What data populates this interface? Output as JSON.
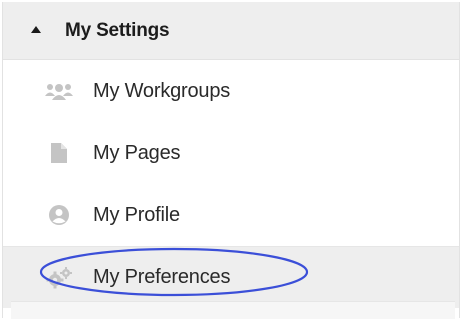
{
  "section": {
    "title": "My Settings",
    "expanded": true
  },
  "menu": {
    "items": [
      {
        "label": "My Workgroups",
        "icon": "users-icon"
      },
      {
        "label": "My Pages",
        "icon": "document-icon"
      },
      {
        "label": "My Profile",
        "icon": "user-circle-icon"
      },
      {
        "label": "My Preferences",
        "icon": "gears-icon",
        "selected": true
      }
    ]
  },
  "colors": {
    "header_bg": "#eeeeee",
    "icon_gray": "#c4c4c4",
    "annotation_blue": "#3b4fd8"
  }
}
